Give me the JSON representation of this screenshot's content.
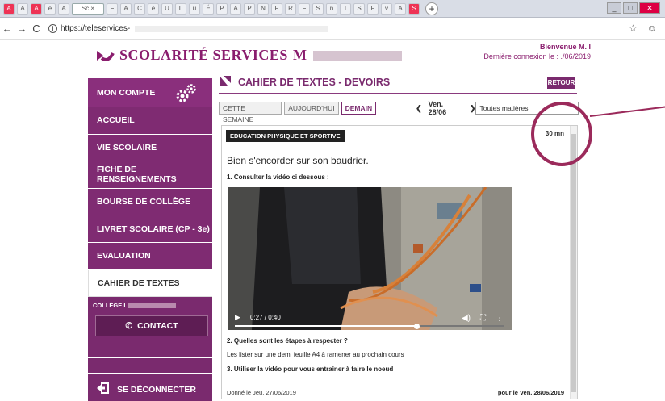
{
  "browser": {
    "active_tab_label": "Sc ×",
    "url": "https://teleservices-",
    "new_tab_glyph": "+"
  },
  "header": {
    "logo_text": "SCOLARITÉ SERVICES",
    "logo_suffix": "M",
    "welcome_line1": "Bienvenue M. I",
    "welcome_line2": "Dernière connexion le : ./06/2019"
  },
  "sidebar": {
    "items": [
      {
        "label": "MON COMPTE"
      },
      {
        "label": "ACCUEIL"
      },
      {
        "label": "VIE SCOLAIRE"
      },
      {
        "label": "FICHE DE RENSEIGNEMENTS"
      },
      {
        "label": "BOURSE DE COLLÈGE"
      },
      {
        "label": "LIVRET SCOLAIRE (CP - 3e)"
      },
      {
        "label": "EVALUATION"
      },
      {
        "label": "CAHIER DE TEXTES"
      }
    ],
    "college_label": "COLLÈGE I",
    "contact_label": "CONTACT",
    "logout_label": "SE DÉCONNECTER"
  },
  "main": {
    "title": "CAHIER DE TEXTES - DEVOIRS",
    "back_label": "RETOUR",
    "filters": [
      "CETTE SEMAINE",
      "AUJOURD'HUI",
      "DEMAIN"
    ],
    "day_label": "Ven. 28/06",
    "subject_select": "Toutes matières"
  },
  "homework": {
    "subject": "EDUCATION PHYSIQUE ET SPORTIVE",
    "duration": "30 mn",
    "title": "Bien s'encorder sur son baudrier.",
    "step1": "1. Consulter la vidéo ci dessous :",
    "video_time": "0:27 / 0:40",
    "video_progress": 0.675,
    "step2": "2. Quelles sont les étapes à respecter ?",
    "step2_text": "Les lister sur une demi feuille A4 à ramener au prochain cours",
    "step3": "3. Utiliser la vidéo pour vous entrainer à faire le noeud",
    "given": "Donné le Jeu. 27/06/2019",
    "due": "pour le Ven. 28/06/2019"
  },
  "colors": {
    "brand": "#7a2a6e",
    "annotation": "#9b2a5b"
  },
  "icons": [
    "back-arrow-icon",
    "forward-arrow-icon",
    "reload-icon",
    "info-icon",
    "star-icon",
    "profile-icon",
    "gears-icon",
    "phone-icon",
    "logout-icon",
    "play-icon",
    "volume-icon",
    "fullscreen-icon",
    "more-icon"
  ]
}
